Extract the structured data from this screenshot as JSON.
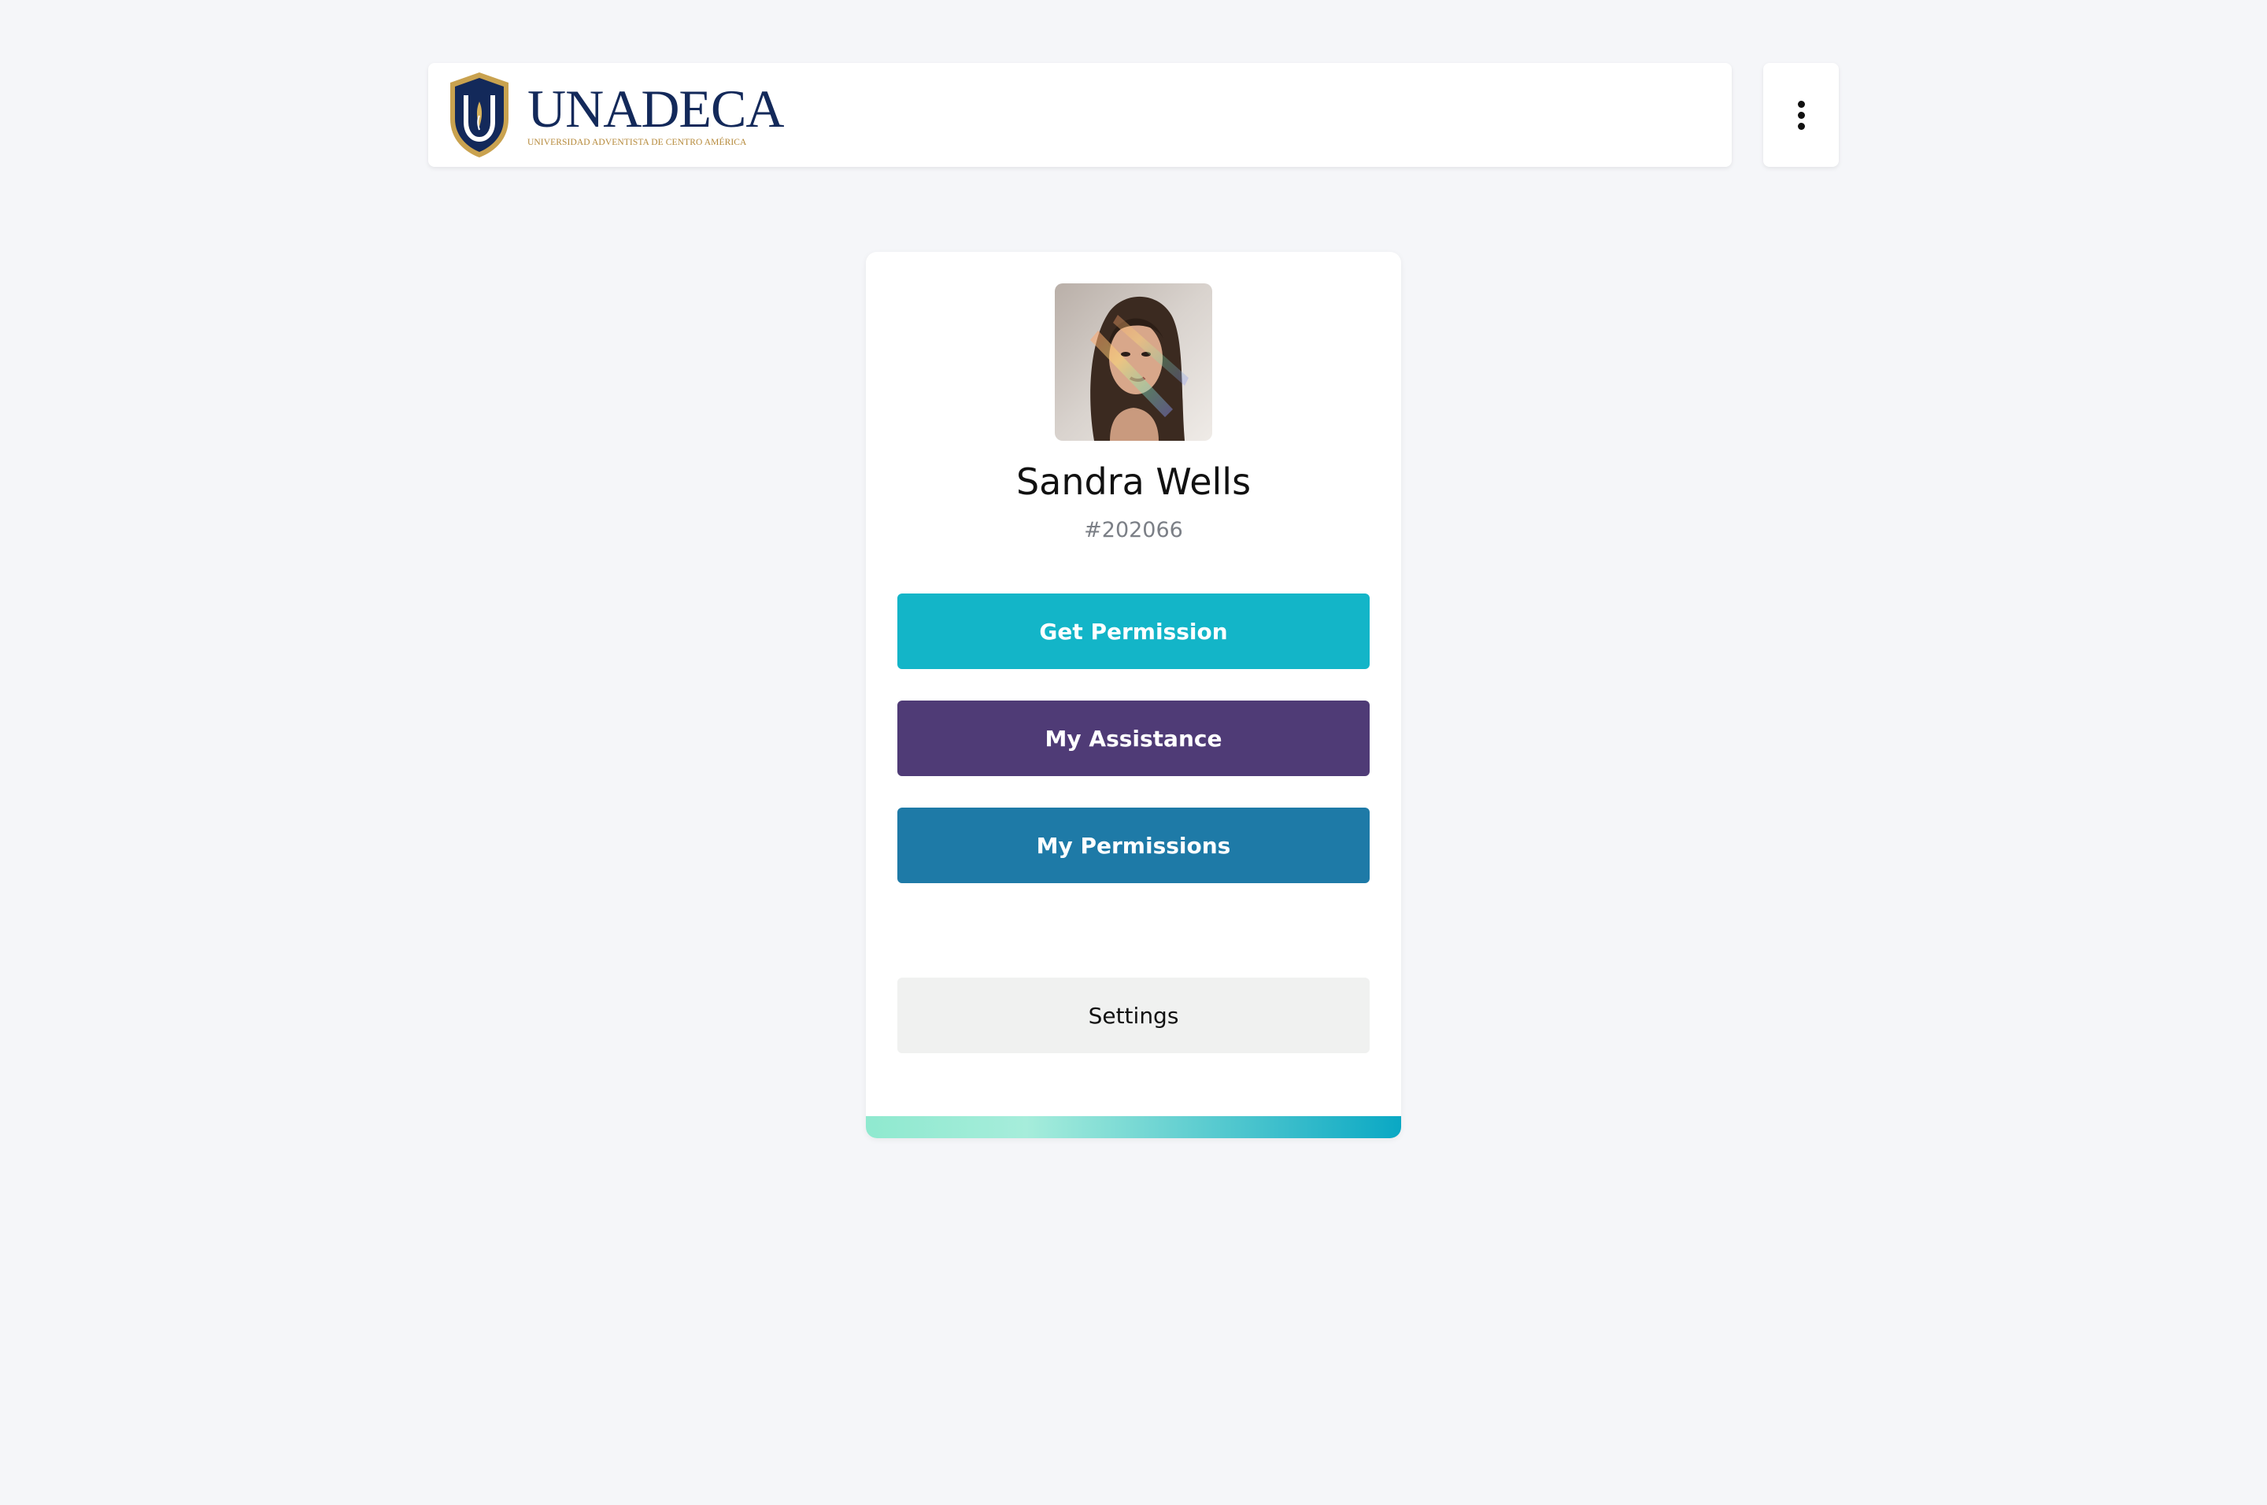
{
  "header": {
    "logo_wordmark": "UNADECA",
    "logo_subtitle": "UNIVERSIDAD ADVENTISTA DE CENTRO AMÉRICA",
    "menu_icon": "kebab-menu-icon"
  },
  "profile": {
    "name": "Sandra Wells",
    "id": "#202066",
    "avatar_alt": "Sandra Wells"
  },
  "actions": {
    "get_permission": "Get Permission",
    "my_assistance": "My Assistance",
    "my_permissions": "My Permissions",
    "settings": "Settings"
  },
  "colors": {
    "page_bg": "#f5f6f9",
    "get_permission": "#13b5c8",
    "my_assistance": "#4f3b76",
    "my_permissions": "#1e7aa7",
    "settings": "#f0f1f0",
    "brand_navy": "#13295a",
    "brand_gold": "#b5893a",
    "footer_gradient_start": "#8fe9cf",
    "footer_gradient_end": "#0aa8c4"
  }
}
